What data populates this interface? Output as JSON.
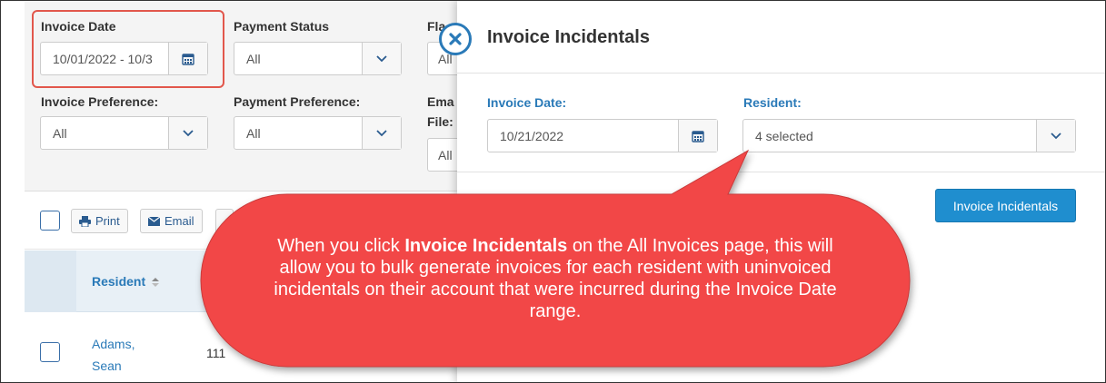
{
  "filters": {
    "invoice_date": {
      "label": "Invoice Date",
      "value": "10/01/2022 - 10/3"
    },
    "payment_status": {
      "label": "Payment Status",
      "value": "All"
    },
    "flag": {
      "label": "Fla",
      "value": "All"
    },
    "invoice_preference": {
      "label": "Invoice Preference:",
      "value": "All"
    },
    "payment_preference": {
      "label": "Payment Preference:",
      "value": "All"
    },
    "email_file": {
      "label_line1": "Ema",
      "label_line2": "File:",
      "value": "All"
    }
  },
  "toolbar": {
    "print_label": "Print",
    "email_label": "Email"
  },
  "table": {
    "header_resident": "Resident",
    "rows": [
      {
        "name_line1": "Adams,",
        "name_line2": "Sean",
        "number": "111"
      }
    ]
  },
  "panel": {
    "title": "Invoice Incidentals",
    "invoice_date_label": "Invoice Date:",
    "invoice_date_value": "10/21/2022",
    "resident_label": "Resident:",
    "resident_value": "4 selected",
    "submit_label": "Invoice Incidentals"
  },
  "callout": {
    "before": "When you click ",
    "bold": "Invoice Incidentals",
    "after": " on the All Invoices page, this will allow you to bulk generate invoices for each resident with uninvoiced incidentals on their account that were incurred during the Invoice Date range."
  },
  "colors": {
    "accent": "#2a7ab8",
    "primary_button": "#1f8ecf",
    "callout": "#f24747",
    "highlight": "#e2574c"
  }
}
